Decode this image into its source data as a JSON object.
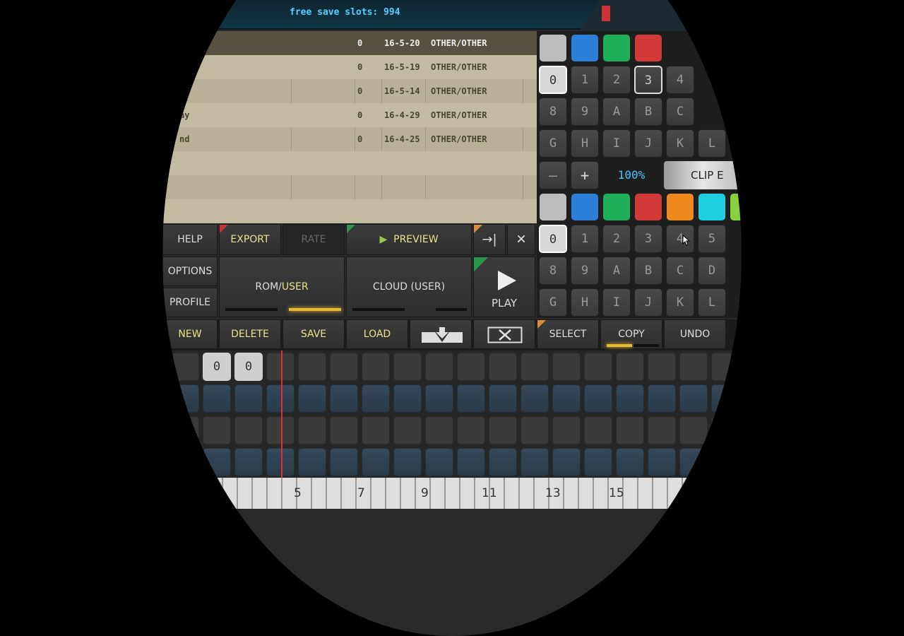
{
  "header": {
    "save_slots": "free save slots: 994"
  },
  "song_list": {
    "rows": [
      {
        "name": "",
        "count": "0",
        "date": "16-5-20",
        "category": "OTHER/OTHER"
      },
      {
        "name": "",
        "count": "0",
        "date": "16-5-19",
        "category": "OTHER/OTHER"
      },
      {
        "name": "",
        "count": "0",
        "date": "16-5-14",
        "category": "OTHER/OTHER"
      },
      {
        "name": "ay",
        "count": "0",
        "date": "16-4-29",
        "category": "OTHER/OTHER"
      },
      {
        "name": "nd",
        "count": "0",
        "date": "16-4-25",
        "category": "OTHER/OTHER"
      }
    ]
  },
  "pads_top": {
    "keys_row1": [
      "0",
      "1",
      "2",
      "3",
      "4"
    ],
    "keys_row2": [
      "8",
      "9",
      "A",
      "B",
      "C"
    ],
    "keys_row3": [
      "G",
      "H",
      "I",
      "J",
      "K",
      "L"
    ]
  },
  "zoom": {
    "minus": "—",
    "plus": "+",
    "value": "100%",
    "clip_label": "CLIP E"
  },
  "pads_bottom": {
    "keys_row1": [
      "0",
      "1",
      "2",
      "3",
      "4",
      "5"
    ],
    "keys_row2": [
      "8",
      "9",
      "A",
      "B",
      "C",
      "D"
    ],
    "keys_row3": [
      "G",
      "H",
      "I",
      "J",
      "K",
      "L"
    ]
  },
  "colors": {
    "grey": "#bdbdbd",
    "blue": "#2b7fd8",
    "green": "#1fae5a",
    "red": "#d23a3a",
    "orange": "#f08a1c",
    "cyan": "#1fd0e0",
    "lime": "#8ad03a"
  },
  "toolbar": {
    "help": "HELP",
    "export": "EXPORT",
    "rate": "RATE",
    "preview": "PREVIEW",
    "next_icon": "→|",
    "close_icon": "✕",
    "options": "OPTIONS",
    "profile": "PROFILE",
    "rom_prefix": "ROM/",
    "rom_user": "USER",
    "cloud": "CLOUD (USER)",
    "play": "PLAY"
  },
  "edit_bar": {
    "new": "NEW",
    "delete": "DELETE",
    "save": "SAVE",
    "load": "LOAD",
    "select": "SELECT",
    "copy": "COPY",
    "undo": "UNDO"
  },
  "sequencer": {
    "first_values": [
      "0",
      "0"
    ]
  },
  "ruler": {
    "numbers": [
      "5",
      "7",
      "9",
      "11",
      "13",
      "15"
    ]
  }
}
